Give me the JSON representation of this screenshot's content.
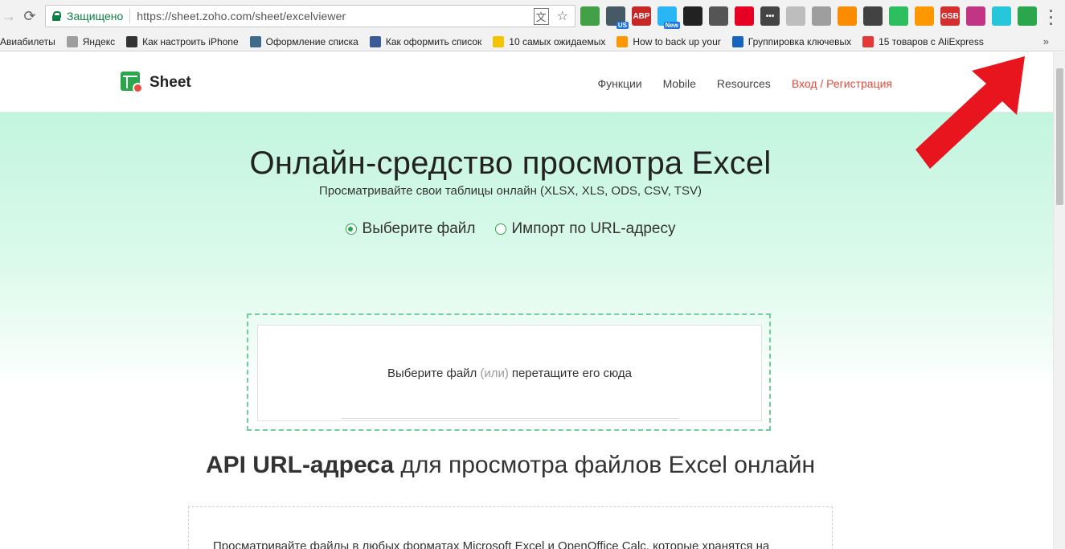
{
  "browser": {
    "secure_label": "Защищено",
    "url": "https://sheet.zoho.com/sheet/excelviewer",
    "extensions": [
      {
        "name": "shield",
        "color": "#43a047",
        "label": ""
      },
      {
        "name": "globe",
        "color": "#455a64",
        "label": "",
        "tag": "US"
      },
      {
        "name": "abp",
        "color": "#c62828",
        "label": "ABP"
      },
      {
        "name": "weather",
        "color": "#29b6f6",
        "label": "",
        "tag": "New"
      },
      {
        "name": "game",
        "color": "#222222",
        "label": ""
      },
      {
        "name": "mail",
        "color": "#555555",
        "label": ""
      },
      {
        "name": "pinterest",
        "color": "#e60023",
        "label": ""
      },
      {
        "name": "dots",
        "color": "#444444",
        "label": "•••"
      },
      {
        "name": "camera",
        "color": "#bdbdbd",
        "label": ""
      },
      {
        "name": "person",
        "color": "#9e9e9e",
        "label": ""
      },
      {
        "name": "colorful",
        "color": "#fb8c00",
        "label": ""
      },
      {
        "name": "download",
        "color": "#424242",
        "label": ""
      },
      {
        "name": "evernote",
        "color": "#2dbe60",
        "label": ""
      },
      {
        "name": "puzzle",
        "color": "#ff9800",
        "label": ""
      },
      {
        "name": "gsb",
        "color": "#d32f2f",
        "label": "GSB"
      },
      {
        "name": "instagram",
        "color": "#c13584",
        "label": ""
      },
      {
        "name": "moon",
        "color": "#26c6da",
        "label": ""
      },
      {
        "name": "sheet",
        "color": "#2ba64d",
        "label": ""
      }
    ]
  },
  "bookmarks": [
    {
      "label": "Авиабилеты",
      "color": "#ffffff"
    },
    {
      "label": "Яндекс",
      "color": "#9e9e9e"
    },
    {
      "label": "Как настроить iPhone",
      "color": "#333333"
    },
    {
      "label": "Оформление списка",
      "color": "#3f6a8a"
    },
    {
      "label": "Как оформить список",
      "color": "#3d5a98"
    },
    {
      "label": "10 самых ожидаемых",
      "color": "#f5c400"
    },
    {
      "label": "How to back up your",
      "color": "#ff9800"
    },
    {
      "label": "Группировка ключевых",
      "color": "#1565c0"
    },
    {
      "label": "15 товаров с AliExpress",
      "color": "#e53935"
    }
  ],
  "site": {
    "logo": "Sheet",
    "nav": [
      "Функции",
      "Mobile",
      "Resources"
    ],
    "login": "Вход / Регистрация"
  },
  "hero": {
    "title": "Онлайн-средство просмотра Excel",
    "subtitle": "Просматривайте свои таблицы онлайн (XLSX, XLS, ODS, CSV, TSV)",
    "radio_file": "Выберите файл",
    "radio_url": "Импорт по URL-адресу",
    "drop_choose": "Выберите файл",
    "drop_or": "(или)",
    "drop_drag": "перетащите его сюда"
  },
  "api": {
    "title_bold": "API URL-адреса",
    "title_rest": "для просмотра файлов Excel онлайн",
    "text": "Просматривайте файлы в любых форматах Microsoft Excel и OpenOffice Calc, которые хранятся на"
  },
  "colors": {
    "accent": "#2ba64d",
    "login": "#e04a3a",
    "arrow": "#e8141e"
  }
}
